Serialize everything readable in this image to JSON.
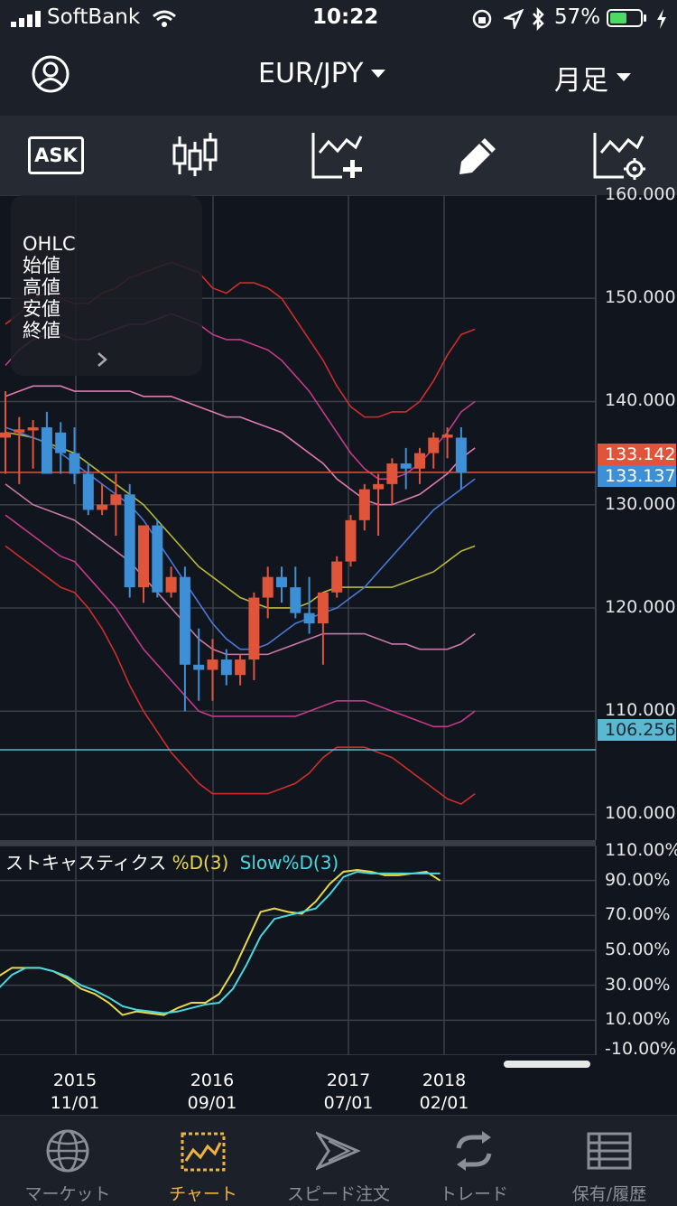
{
  "status_bar": {
    "carrier": "SoftBank",
    "time": "10:22",
    "battery_percent": "57%",
    "battery_level": 0.57
  },
  "nav": {
    "pair": "EUR/JPY",
    "period": "月足"
  },
  "toolbar": {
    "ask_label": "ASK"
  },
  "ohlc_panel": {
    "title": "OHLC",
    "open": "始値",
    "high": "高値",
    "low": "安値",
    "close": "終値"
  },
  "price_labels": {
    "ask": "133.142",
    "bid": "133.137",
    "line": "106.256"
  },
  "stoch_legend": {
    "name": "ストキャスティクス",
    "d": "%D(3)",
    "slow": "Slow%D(3)"
  },
  "x_axis": [
    {
      "year": "2015",
      "date": "11/01"
    },
    {
      "year": "2016",
      "date": "09/01"
    },
    {
      "year": "2017",
      "date": "07/01"
    },
    {
      "year": "2018",
      "date": "02/01"
    }
  ],
  "tabs": [
    {
      "label": "マーケット"
    },
    {
      "label": "チャート"
    },
    {
      "label": "スピード注文"
    },
    {
      "label": "トレード"
    },
    {
      "label": "保有/履歴"
    }
  ],
  "chart_data": [
    {
      "type": "candlestick",
      "title": "EUR/JPY",
      "ylim": [
        97.5,
        160
      ],
      "y_ticks": [
        "160.000",
        "150.000",
        "140.000",
        "130.000",
        "120.000",
        "110.000",
        "100.000"
      ],
      "colors": {
        "up": "#e0553a",
        "down": "#3d8fd6"
      },
      "candles": [
        {
          "o": 136.5,
          "h": 141.0,
          "l": 133.0,
          "c": 137.0
        },
        {
          "o": 137.0,
          "h": 138.5,
          "l": 132.0,
          "c": 137.3
        },
        {
          "o": 137.2,
          "h": 138.2,
          "l": 133.5,
          "c": 137.5
        },
        {
          "o": 137.5,
          "h": 139.0,
          "l": 133.0,
          "c": 133.0
        },
        {
          "o": 137.0,
          "h": 138.0,
          "l": 133.0,
          "c": 135.0
        },
        {
          "o": 135.0,
          "h": 137.5,
          "l": 132.0,
          "c": 133.0
        },
        {
          "o": 133.0,
          "h": 134.0,
          "l": 129.0,
          "c": 129.5
        },
        {
          "o": 129.5,
          "h": 132.0,
          "l": 129.0,
          "c": 130.0
        },
        {
          "o": 130.0,
          "h": 133.0,
          "l": 127.0,
          "c": 131.0
        },
        {
          "o": 131.0,
          "h": 132.0,
          "l": 121.0,
          "c": 122.0
        },
        {
          "o": 122.0,
          "h": 128.0,
          "l": 120.5,
          "c": 128.0
        },
        {
          "o": 128.0,
          "h": 128.5,
          "l": 121.0,
          "c": 121.5
        },
        {
          "o": 121.5,
          "h": 124.0,
          "l": 121.0,
          "c": 123.0
        },
        {
          "o": 123.0,
          "h": 124.0,
          "l": 110.0,
          "c": 114.5
        },
        {
          "o": 114.5,
          "h": 118.0,
          "l": 111.0,
          "c": 114.0
        },
        {
          "o": 114.0,
          "h": 117.0,
          "l": 111.0,
          "c": 115.0
        },
        {
          "o": 115.0,
          "h": 116.0,
          "l": 112.5,
          "c": 113.5
        },
        {
          "o": 113.5,
          "h": 115.5,
          "l": 112.5,
          "c": 115.0
        },
        {
          "o": 115.0,
          "h": 121.5,
          "l": 113.0,
          "c": 121.0
        },
        {
          "o": 121.0,
          "h": 124.0,
          "l": 119.0,
          "c": 123.0
        },
        {
          "o": 123.0,
          "h": 124.0,
          "l": 120.5,
          "c": 122.0
        },
        {
          "o": 122.0,
          "h": 124.0,
          "l": 119.0,
          "c": 119.5
        },
        {
          "o": 119.5,
          "h": 123.0,
          "l": 117.5,
          "c": 118.5
        },
        {
          "o": 118.5,
          "h": 120.0,
          "l": 114.5,
          "c": 121.5
        },
        {
          "o": 121.5,
          "h": 125.0,
          "l": 121.0,
          "c": 124.5
        },
        {
          "o": 124.5,
          "h": 129.0,
          "l": 124.0,
          "c": 128.5
        },
        {
          "o": 128.5,
          "h": 132.0,
          "l": 127.5,
          "c": 131.5
        },
        {
          "o": 131.5,
          "h": 133.0,
          "l": 127.0,
          "c": 132.0
        },
        {
          "o": 132.0,
          "h": 134.5,
          "l": 130.0,
          "c": 134.0
        },
        {
          "o": 134.0,
          "h": 135.5,
          "l": 131.5,
          "c": 133.5
        },
        {
          "o": 133.5,
          "h": 135.5,
          "l": 132.0,
          "c": 135.0
        },
        {
          "o": 135.0,
          "h": 137.0,
          "l": 133.5,
          "c": 136.5
        },
        {
          "o": 136.5,
          "h": 137.5,
          "l": 134.5,
          "c": 136.8
        },
        {
          "o": 136.5,
          "h": 137.5,
          "l": 131.5,
          "c": 133.1
        }
      ],
      "bands": [
        {
          "name": "upper3",
          "color": "#cf2e2a",
          "values": [
            147.5,
            148.5,
            150.0,
            150.5,
            150.0,
            149.5,
            149.5,
            150.5,
            151.0,
            152.0,
            152.5,
            153.0,
            153.5,
            153.0,
            152.5,
            151.0,
            150.5,
            151.5,
            151.5,
            151.0,
            150.0,
            148.0,
            146.0,
            144.0,
            141.5,
            139.5,
            138.5,
            138.5,
            139.0,
            139.0,
            140.0,
            142.0,
            144.5,
            146.5,
            147.0
          ]
        },
        {
          "name": "upper2",
          "color": "#c43a8a",
          "values": [
            143.5,
            145.0,
            146.0,
            146.5,
            146.5,
            146.0,
            146.0,
            146.5,
            147.0,
            147.5,
            147.5,
            148.0,
            148.5,
            148.0,
            147.5,
            146.5,
            146.0,
            146.0,
            145.5,
            145.0,
            144.0,
            142.5,
            141.0,
            139.0,
            137.0,
            135.0,
            133.5,
            132.5,
            132.5,
            133.0,
            134.0,
            135.5,
            137.0,
            139.0,
            140.0
          ]
        },
        {
          "name": "upper1",
          "color": "#e07ab0",
          "values": [
            140.5,
            141.0,
            141.5,
            141.5,
            141.5,
            141.0,
            141.0,
            141.0,
            141.0,
            141.0,
            140.5,
            140.5,
            140.5,
            140.0,
            139.5,
            139.0,
            138.5,
            138.5,
            138.0,
            137.5,
            137.0,
            136.0,
            135.0,
            134.0,
            132.5,
            131.5,
            130.5,
            130.0,
            130.0,
            130.5,
            131.0,
            132.0,
            133.0,
            134.5,
            135.5
          ]
        },
        {
          "name": "middle",
          "color": "#b8b83a",
          "values": [
            137.0,
            136.8,
            136.5,
            136.0,
            135.5,
            135.0,
            134.0,
            133.0,
            132.0,
            131.0,
            130.0,
            128.5,
            127.0,
            125.5,
            124.0,
            123.0,
            122.0,
            121.0,
            120.5,
            120.0,
            120.0,
            120.0,
            120.5,
            121.5,
            122.0,
            122.0,
            122.0,
            122.0,
            122.0,
            122.5,
            123.0,
            123.5,
            124.5,
            125.5,
            126.0
          ]
        },
        {
          "name": "lower1",
          "color": "#c878a8",
          "values": [
            132.0,
            131.0,
            130.0,
            129.5,
            129.0,
            128.5,
            127.5,
            126.5,
            125.5,
            124.5,
            123.0,
            121.5,
            120.0,
            118.5,
            117.0,
            116.0,
            115.5,
            115.5,
            115.5,
            115.5,
            116.0,
            116.5,
            117.0,
            117.5,
            117.5,
            117.5,
            117.5,
            117.0,
            116.5,
            116.5,
            116.0,
            116.0,
            116.0,
            116.5,
            117.5
          ]
        },
        {
          "name": "lower2",
          "color": "#c43a8a",
          "values": [
            129.0,
            128.0,
            127.0,
            126.0,
            125.0,
            124.5,
            123.0,
            121.5,
            120.0,
            118.0,
            116.0,
            114.5,
            113.0,
            111.5,
            110.0,
            109.5,
            109.5,
            109.5,
            109.5,
            109.5,
            109.5,
            109.5,
            110.0,
            110.5,
            111.0,
            111.0,
            111.0,
            110.5,
            110.0,
            109.5,
            109.0,
            108.5,
            108.5,
            109.0,
            110.0
          ]
        },
        {
          "name": "lower3",
          "color": "#cf2e2a",
          "values": [
            126.0,
            125.0,
            124.0,
            123.0,
            122.0,
            121.5,
            120.0,
            118.0,
            115.5,
            112.5,
            110.0,
            108.0,
            106.0,
            104.5,
            103.0,
            102.0,
            102.0,
            102.0,
            102.0,
            102.0,
            102.5,
            103.0,
            104.0,
            105.5,
            106.5,
            106.5,
            106.5,
            106.0,
            105.5,
            104.5,
            103.5,
            102.5,
            101.5,
            101.0,
            102.0
          ]
        },
        {
          "name": "ma",
          "color": "#4a78d8",
          "values": [
            137.5,
            137.0,
            136.5,
            136.0,
            135.0,
            134.0,
            133.0,
            132.0,
            131.0,
            130.0,
            128.5,
            126.5,
            124.5,
            122.5,
            120.5,
            118.5,
            117.0,
            116.0,
            116.0,
            116.5,
            117.5,
            118.5,
            119.0,
            119.5,
            120.0,
            121.0,
            122.0,
            123.5,
            125.0,
            126.5,
            128.0,
            129.5,
            130.5,
            131.5,
            132.5
          ]
        }
      ],
      "horizontal_lines": [
        {
          "value": 133.142,
          "color": "#e0553a"
        },
        {
          "value": 106.256,
          "color": "#5ab8d0"
        }
      ]
    },
    {
      "type": "line",
      "title": "ストキャスティクス",
      "ylim": [
        -10,
        110
      ],
      "y_ticks": [
        "110.00%",
        "90.00%",
        "70.00%",
        "50.00%",
        "30.00%",
        "10.00%",
        "-10.00%"
      ],
      "series": [
        {
          "name": "%D(3)",
          "color": "#e8d84a",
          "values": [
            35,
            40,
            40,
            40,
            38,
            34,
            28,
            25,
            20,
            13,
            15,
            14,
            13,
            17,
            20,
            20,
            25,
            38,
            55,
            72,
            74,
            72,
            71,
            78,
            88,
            95,
            96,
            95,
            93,
            93,
            94,
            95,
            90
          ]
        },
        {
          "name": "Slow%D(3)",
          "color": "#4ad8e0",
          "values": [
            28,
            36,
            40,
            40,
            38,
            35,
            30,
            27,
            23,
            18,
            16,
            15,
            14,
            15,
            17,
            19,
            20,
            28,
            42,
            58,
            68,
            70,
            72,
            74,
            82,
            92,
            95,
            94,
            94,
            94,
            94,
            94,
            94
          ]
        }
      ]
    }
  ]
}
